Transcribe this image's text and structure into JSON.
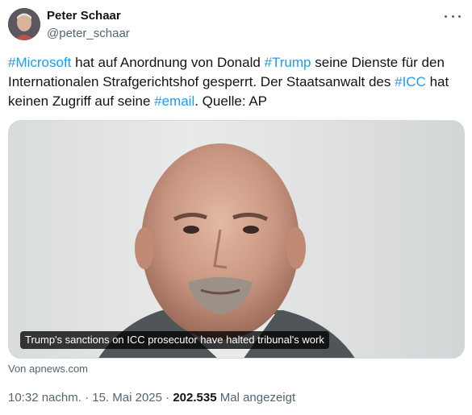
{
  "author": {
    "display_name": "Peter Schaar",
    "handle": "@peter_schaar"
  },
  "tweet": {
    "segments": [
      {
        "text": "#Microsoft",
        "hashtag": true
      },
      {
        "text": " hat auf Anordnung von Donald ",
        "hashtag": false
      },
      {
        "text": "#Trump",
        "hashtag": true
      },
      {
        "text": " seine Dienste für den Internationalen Strafgerichtshof gesperrt. Der Staatsanwalt des ",
        "hashtag": false
      },
      {
        "text": "#ICC",
        "hashtag": true
      },
      {
        "text": " hat keinen Zugriff auf seine ",
        "hashtag": false
      },
      {
        "text": "#email",
        "hashtag": true
      },
      {
        "text": ". Quelle: AP",
        "hashtag": false
      }
    ]
  },
  "media": {
    "caption": "Trump's sanctions on ICC prosecutor have halted tribunal's work",
    "source": "Von apnews.com"
  },
  "meta": {
    "time": "10:32 nachm.",
    "separator": "·",
    "date": "15. Mai 2025",
    "views_count": "202.535",
    "views_label": "Mal angezeigt"
  },
  "colors": {
    "hashtag": "#1d9bf0",
    "secondary_text": "#536471",
    "primary_text": "#0f1419"
  },
  "icons": {
    "more": "more-horizontal-icon"
  }
}
